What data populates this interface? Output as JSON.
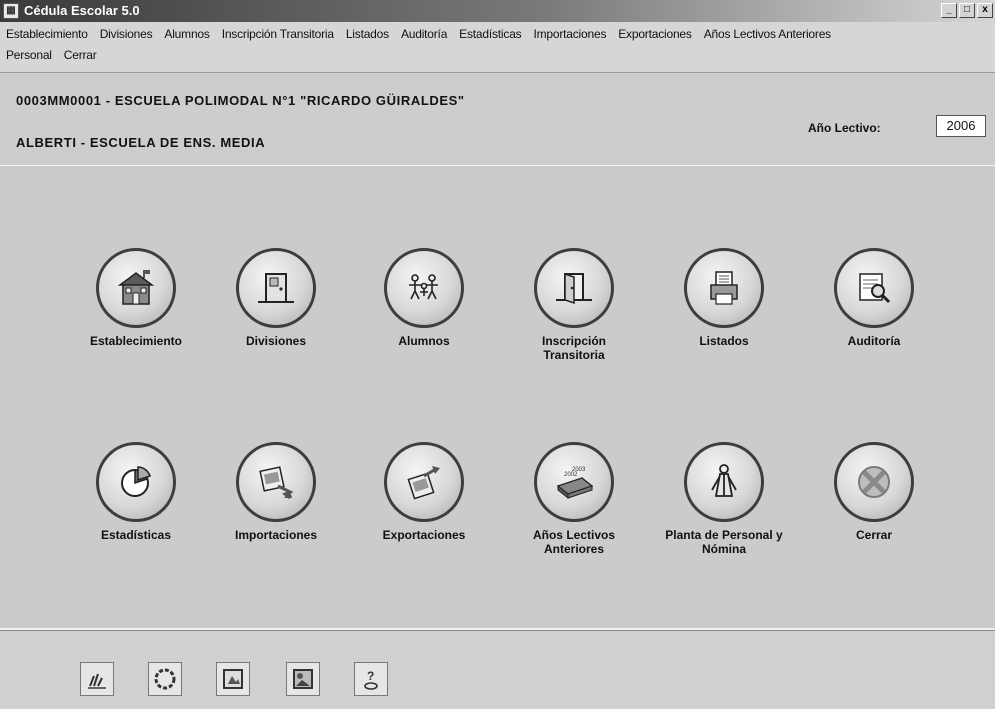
{
  "window": {
    "title": "Cédula Escolar 5.0",
    "buttons": [
      "_",
      "□",
      "x"
    ]
  },
  "menu": {
    "row1": [
      "Establecimiento",
      "Divisiones",
      "Alumnos",
      "Inscripción Transitoria",
      "Listados",
      "Auditoría",
      "Estadísticas",
      "Importaciones",
      "Exportaciones",
      "Años Lectivos Anteriores"
    ],
    "row2": [
      "Personal",
      "Cerrar"
    ]
  },
  "header": {
    "school_code": "0003MM0001 - ESCUELA POLIMODAL N°1 \"RICARDO GÜIRALDES\"",
    "school_place": "ALBERTI - ESCUELA DE ENS. MEDIA",
    "year_label": "Año Lectivo:",
    "year_value": "2006"
  },
  "tiles": [
    {
      "label": "Establecimiento",
      "icon": "school-building-icon"
    },
    {
      "label": "Divisiones",
      "icon": "door-icon"
    },
    {
      "label": "Alumnos",
      "icon": "students-icon"
    },
    {
      "label": "Inscripción Transitoria",
      "icon": "open-door-icon"
    },
    {
      "label": "Listados",
      "icon": "printer-icon"
    },
    {
      "label": "Auditoría",
      "icon": "magnifier-document-icon"
    },
    {
      "label": "Estadísticas",
      "icon": "pie-chart-icon"
    },
    {
      "label": "Importaciones",
      "icon": "import-icon"
    },
    {
      "label": "Exportaciones",
      "icon": "export-icon"
    },
    {
      "label": "Años Lectivos Anteriores",
      "icon": "archive-records-icon"
    },
    {
      "label": "Planta de Personal y Nómina",
      "icon": "person-icon"
    },
    {
      "label": "Cerrar",
      "icon": "close-icon"
    }
  ],
  "toolbar": [
    "hand-tool-icon",
    "circle-tool-icon",
    "image-tool-icon",
    "picture-tool-icon",
    "help-tool-icon"
  ]
}
